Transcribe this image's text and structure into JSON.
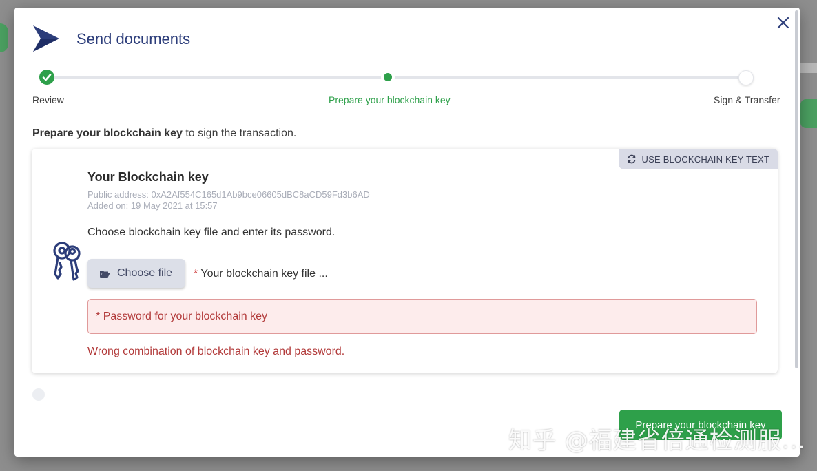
{
  "modal": {
    "title": "Send documents"
  },
  "stepper": {
    "steps": [
      {
        "label": "Review",
        "state": "completed"
      },
      {
        "label": "Prepare your blockchain key",
        "state": "active"
      },
      {
        "label": "Sign & Transfer",
        "state": "pending"
      }
    ]
  },
  "intro": {
    "bold": "Prepare your blockchain key",
    "rest": " to sign the transaction."
  },
  "card": {
    "use_text_button": "USE BLOCKCHAIN KEY TEXT",
    "title": "Your Blockchain key",
    "public_address": "Public address: 0xA2Af554C165d1Ab9bce06605dBC8aCD59Fd3b6AD",
    "added_on": "Added on: 19 May 2021 at 15:57",
    "instruction": "Choose blockchain key file and enter its password.",
    "choose_file_button": "Choose file",
    "file_required_mark": "*",
    "file_placeholder": "Your blockchain key file ...",
    "password_required_mark": "*",
    "password_placeholder": "Password for your blockchain key",
    "error_message": "Wrong combination of blockchain key and password."
  },
  "footer": {
    "submit_button": "Prepare your blockchain key"
  },
  "watermark": "知乎 @福建省倍通检测服...",
  "colors": {
    "accent_green": "#2ea04a",
    "brand_navy": "#2c3d7a",
    "error_red": "#b23a3a"
  }
}
